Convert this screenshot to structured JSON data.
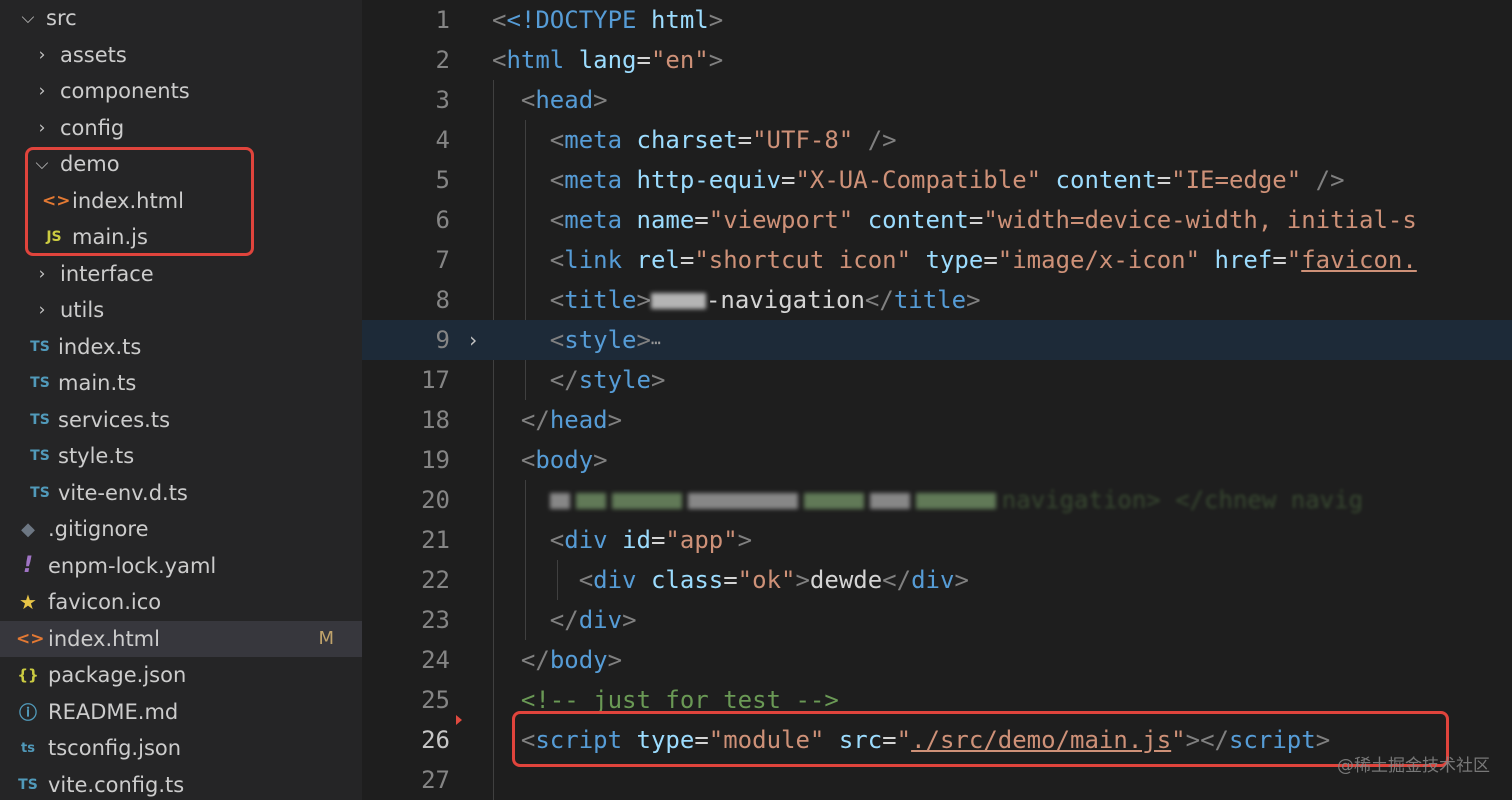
{
  "explorer": {
    "items": [
      {
        "label": "src",
        "kind": "folder-open",
        "indent": 0
      },
      {
        "label": "assets",
        "kind": "folder",
        "indent": 1
      },
      {
        "label": "components",
        "kind": "folder",
        "indent": 1
      },
      {
        "label": "config",
        "kind": "folder",
        "indent": 1
      },
      {
        "label": "demo",
        "kind": "folder-open",
        "indent": 1
      },
      {
        "label": "index.html",
        "kind": "html",
        "indent": 2
      },
      {
        "label": "main.js",
        "kind": "js",
        "indent": 2
      },
      {
        "label": "interface",
        "kind": "folder",
        "indent": 1
      },
      {
        "label": "utils",
        "kind": "folder",
        "indent": 1
      },
      {
        "label": "index.ts",
        "kind": "ts",
        "indent": 1
      },
      {
        "label": "main.ts",
        "kind": "ts",
        "indent": 1
      },
      {
        "label": "services.ts",
        "kind": "ts",
        "indent": 1
      },
      {
        "label": "style.ts",
        "kind": "ts",
        "indent": 1
      },
      {
        "label": "vite-env.d.ts",
        "kind": "ts",
        "indent": 1
      },
      {
        "label": ".gitignore",
        "kind": "git",
        "indent": 0
      },
      {
        "label": "enpm-lock.yaml",
        "kind": "yaml",
        "indent": 0
      },
      {
        "label": "favicon.ico",
        "kind": "star",
        "indent": 0
      },
      {
        "label": "index.html",
        "kind": "html",
        "indent": 0,
        "selected": true,
        "badge": "M"
      },
      {
        "label": "package.json",
        "kind": "json",
        "indent": 0
      },
      {
        "label": "README.md",
        "kind": "info",
        "indent": 0
      },
      {
        "label": "tsconfig.json",
        "kind": "tsconfig",
        "indent": 0
      },
      {
        "label": "vite.config.ts",
        "kind": "ts",
        "indent": 0
      }
    ]
  },
  "icons": {
    "folder": "chevron-right-icon",
    "folder-open": "chevron-down-icon",
    "html": "html-file-icon",
    "js": "js-file-icon",
    "ts": "ts-file-icon",
    "git": "git-file-icon",
    "yaml": "yaml-file-icon",
    "star": "favicon-file-icon",
    "json": "json-file-icon",
    "info": "readme-file-icon",
    "tsconfig": "tsconfig-file-icon"
  },
  "icon_glyphs": {
    "html": "<>",
    "js": "JS",
    "ts": "TS",
    "git": "◆",
    "yaml": "!",
    "star": "★",
    "json": "{}",
    "info": "ⓘ",
    "tsconfig": "ts"
  },
  "editor": {
    "line_numbers": [
      "1",
      "2",
      "3",
      "4",
      "5",
      "6",
      "7",
      "8",
      "9",
      "17",
      "18",
      "19",
      "20",
      "21",
      "22",
      "23",
      "24",
      "25",
      "26",
      "27"
    ],
    "current_line": "26",
    "folded_line_placeholder": "⋯",
    "blurred_title_suffix": "-navigation",
    "blurred_line_text": "navigation> </chnew navig",
    "lines": {
      "l1": {
        "doctype": "<!DOCTYPE",
        "html": "html"
      },
      "l2": {
        "tag": "html",
        "attr": "lang",
        "val": "\"en\""
      },
      "l3": {
        "tag": "head"
      },
      "l4": {
        "tag": "meta",
        "attr": "charset",
        "val": "\"UTF-8\"",
        "close": "/>"
      },
      "l5": {
        "tag": "meta",
        "attr1": "http-equiv",
        "val1": "\"X-UA-Compatible\"",
        "attr2": "content",
        "val2": "\"IE=edge\"",
        "close": "/>"
      },
      "l6": {
        "tag": "meta",
        "attr1": "name",
        "val1": "\"viewport\"",
        "attr2": "content",
        "val2": "\"width=device-width, initial-s"
      },
      "l7": {
        "tag": "link",
        "attr1": "rel",
        "val1": "\"shortcut icon\"",
        "attr2": "type",
        "val2": "\"image/x-icon\"",
        "attr3": "href",
        "val3q": "\"",
        "val3": "favicon."
      },
      "l8": {
        "tag": "title",
        "endtag": "title"
      },
      "l9": {
        "tag": "style"
      },
      "l17": {
        "endtag": "style"
      },
      "l18": {
        "endtag": "head"
      },
      "l19": {
        "tag": "body"
      },
      "l21": {
        "tag": "div",
        "attr": "id",
        "val": "\"app\""
      },
      "l22": {
        "tag": "div",
        "attr": "class",
        "val": "\"ok\"",
        "text": "dewde",
        "endtag": "div"
      },
      "l23": {
        "endtag": "div"
      },
      "l24": {
        "endtag": "body"
      },
      "l25": {
        "comment": "<!-- just for test -->"
      },
      "l26": {
        "tag": "script",
        "attr1": "type",
        "val1": "\"module\"",
        "attr2": "src",
        "q": "\"",
        "path": "./src/demo/main.js",
        "endtag": "script"
      }
    }
  },
  "watermark": "@稀土掘金技术社区",
  "colors": {
    "highlight_box": "#e0443c"
  }
}
